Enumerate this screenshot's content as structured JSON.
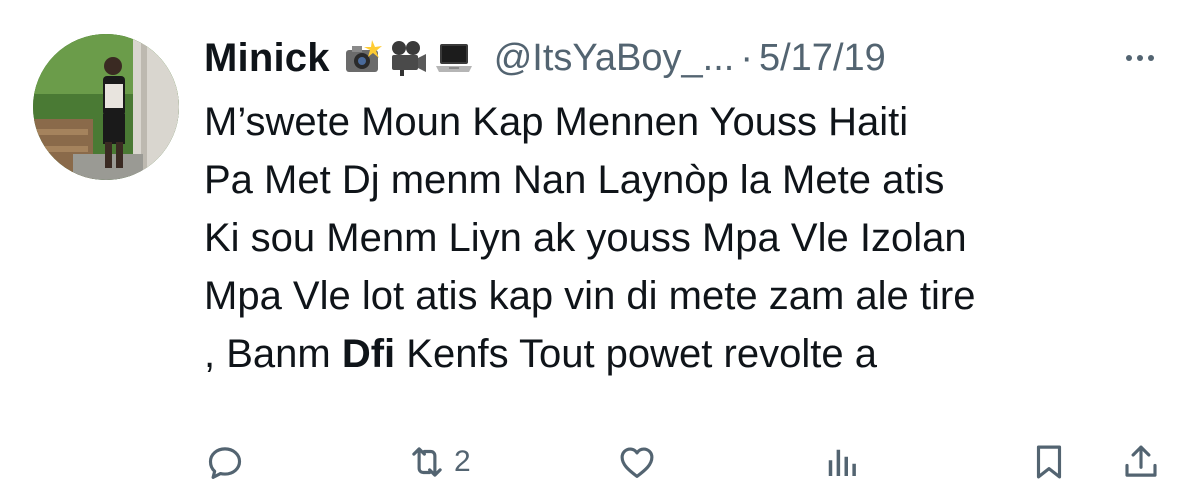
{
  "tweet": {
    "display_name": "Minick",
    "emojis": [
      "camera-flash-icon",
      "movie-camera-icon",
      "laptop-icon"
    ],
    "handle": "@ItsYaBoy_...",
    "separator": "·",
    "date": "5/17/19",
    "more_label": "···",
    "body_lines": [
      "M’swete Moun Kap Mennen Youss Haiti",
      "Pa Met Dj menm Nan Laynòp la Mete atis",
      "Ki sou Menm Liyn ak youss Mpa Vle Izolan",
      "Mpa Vle lot atis kap vin di mete zam ale tire"
    ],
    "last_line": {
      "prefix": ", Banm ",
      "bold": "Dfi",
      "suffix": " Kenfs Tout powet revolte a"
    }
  },
  "actions": {
    "reply_icon": "reply-icon",
    "retweet_icon": "retweet-icon",
    "retweet_count": "2",
    "like_icon": "heart-icon",
    "views_icon": "views-icon",
    "bookmark_icon": "bookmark-icon",
    "share_icon": "share-icon"
  },
  "colors": {
    "text": "#0f1419",
    "secondary": "#536471"
  }
}
